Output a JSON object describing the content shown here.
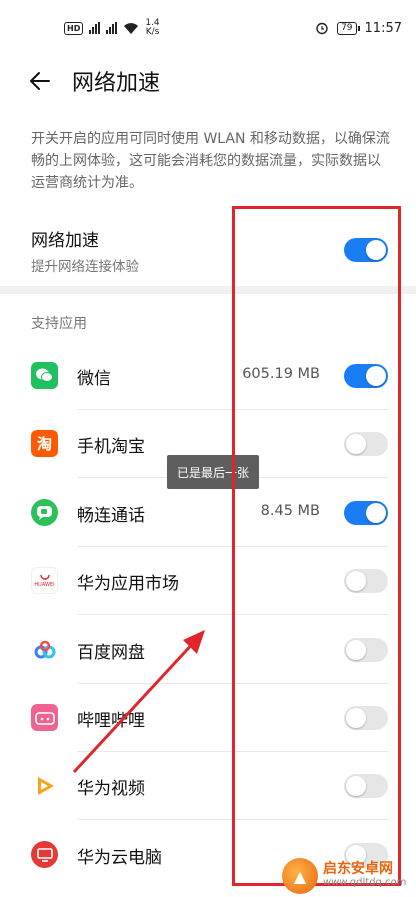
{
  "status_bar": {
    "hd_badge": "HD",
    "net_speed_value": "1.4",
    "net_speed_unit": "K/s",
    "battery": "79",
    "time": "11:57"
  },
  "header": {
    "title": "网络加速"
  },
  "description": "开关开启的应用可同时使用 WLAN 和移动数据，以确保流畅的上网体验，这可能会消耗您的数据流量，实际数据以运营商统计为准。",
  "master": {
    "title": "网络加速",
    "subtitle": "提升网络连接体验",
    "enabled": true
  },
  "section_label": "支持应用",
  "apps": [
    {
      "name": "微信",
      "usage": "605.19 MB",
      "enabled": true,
      "icon": "wechat-icon",
      "color": "#1fc15f"
    },
    {
      "name": "手机淘宝",
      "usage": "",
      "enabled": false,
      "icon": "taobao-icon",
      "color": "#ff5a00",
      "glyph": "淘"
    },
    {
      "name": "畅连通话",
      "usage": "8.45 MB",
      "enabled": true,
      "icon": "meetime-icon",
      "color": "#2bc05a"
    },
    {
      "name": "华为应用市场",
      "usage": "",
      "enabled": false,
      "icon": "appgallery-icon",
      "color": "#e4252c",
      "glyph": "HUAWEI"
    },
    {
      "name": "百度网盘",
      "usage": "",
      "enabled": false,
      "icon": "baidu-netdisk-icon",
      "color": "#3a7ff6"
    },
    {
      "name": "哔哩哔哩",
      "usage": "",
      "enabled": false,
      "icon": "bilibili-icon",
      "color": "#f06292"
    },
    {
      "name": "华为视频",
      "usage": "",
      "enabled": false,
      "icon": "huawei-video-icon",
      "color": "#f7a21b"
    },
    {
      "name": "华为云电脑",
      "usage": "",
      "enabled": false,
      "icon": "cloud-pc-icon",
      "color": "#e53935"
    }
  ],
  "toast": "已是最后一张",
  "watermark": {
    "title": "启东安卓网",
    "url": "www.qdltdq.com"
  },
  "colors": {
    "accent": "#1a7df5",
    "annotation": "#e0252b"
  }
}
